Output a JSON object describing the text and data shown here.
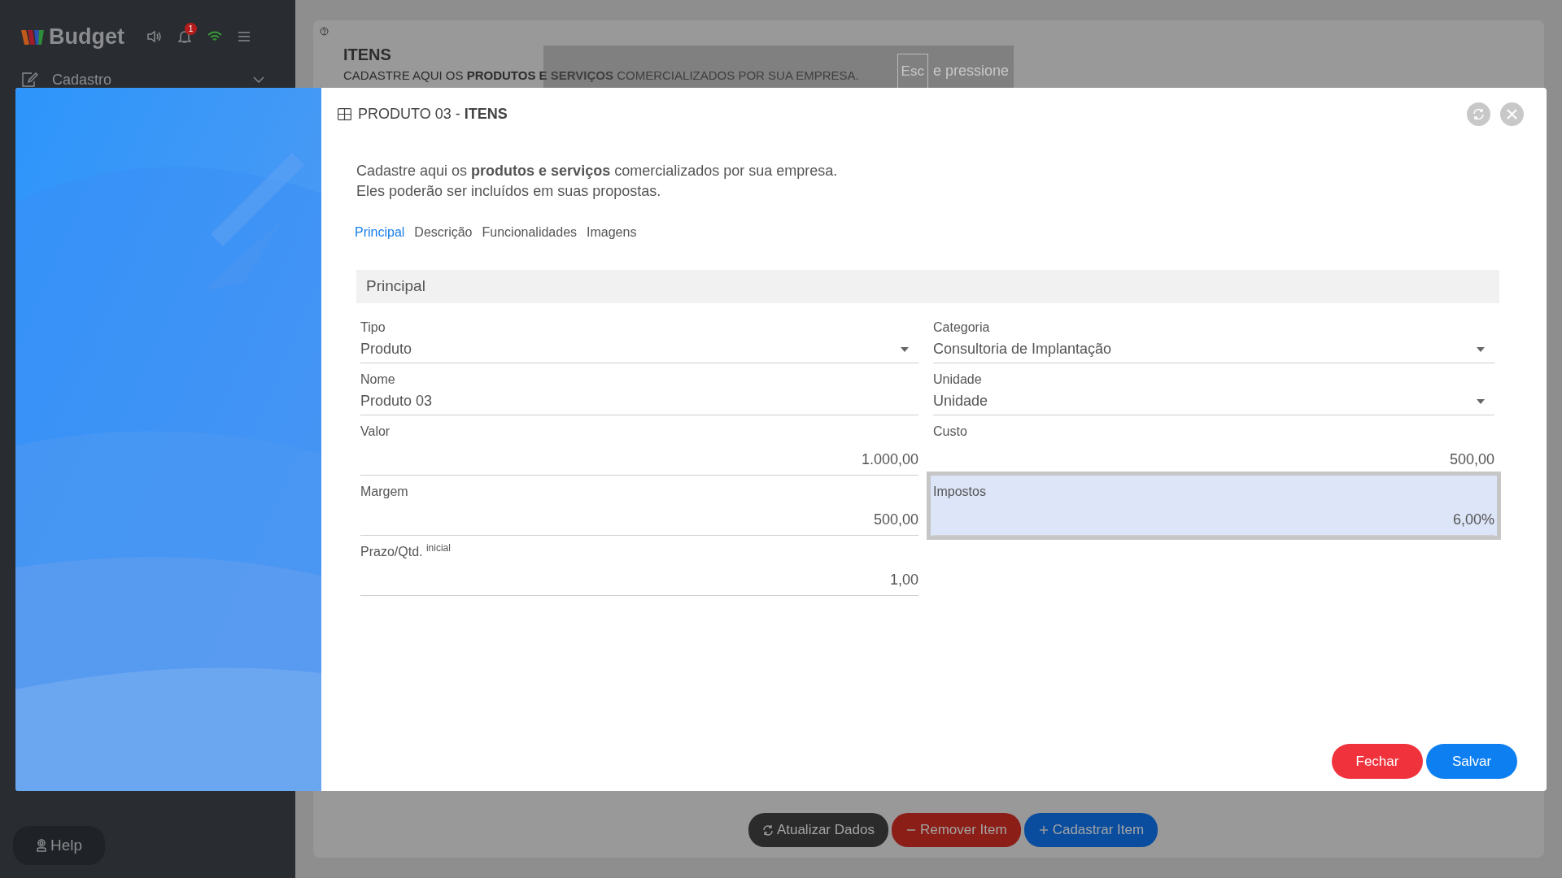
{
  "sidebar": {
    "logo": "Budget",
    "notification_count": "1",
    "menu": [
      {
        "label": "Cadastro",
        "expanded": false
      }
    ],
    "help": "Help"
  },
  "page": {
    "title": "ITENS",
    "subtitle": "CADASTRE AQUI OS **PRODUTOS E SERVIÇOS** COMERCIALIZADOS POR SUA EMPRESA.",
    "tooltip": {
      "key": "Esc",
      "text": "e pressione"
    },
    "buttons": [
      {
        "label": "Atualizar Dados",
        "kind": "refresh"
      },
      {
        "label": "Remover Item",
        "kind": "remove"
      },
      {
        "label": "Cadastrar Item",
        "kind": "add"
      }
    ]
  },
  "modal": {
    "title": "PRODUTO 03 - **ITENS**",
    "description": [
      "Cadastre aqui os **produtos e serviços** comercializados por sua empresa.",
      "Eles poderão ser incluídos em suas propostas."
    ],
    "tabs": [
      {
        "label": "Principal",
        "selected": true
      },
      {
        "label": "Descrição",
        "selected": false
      },
      {
        "label": "Funcionalidades",
        "selected": false
      },
      {
        "label": "Imagens",
        "selected": false
      }
    ],
    "section": "Principal",
    "fields": [
      {
        "label": "Tipo",
        "value": "Produto",
        "kind": "select",
        "focused": false
      },
      {
        "label": "Categoria",
        "value": "Consultoria de Implantação",
        "kind": "select",
        "focused": false
      },
      {
        "label": "Nome",
        "value": "Produto 03",
        "kind": "text",
        "focused": false
      },
      {
        "label": "Unidade",
        "value": "Unidade",
        "kind": "select",
        "focused": false
      },
      {
        "label": "Valor",
        "value": "1.000,00",
        "kind": "number",
        "focused": false
      },
      {
        "label": "Custo",
        "value": "500,00",
        "kind": "number",
        "focused": false
      },
      {
        "label": "Margem",
        "value": "500,00",
        "kind": "number",
        "focused": false
      },
      {
        "label": "Impostos",
        "value": "6,00%",
        "kind": "number",
        "focused": true
      },
      {
        "label": "Prazo/Qtd. $^{inicial}$",
        "value": "1,00",
        "kind": "number",
        "focused": false
      }
    ],
    "buttons": [
      {
        "label": "Fechar",
        "kind": "close"
      },
      {
        "label": "Salvar",
        "kind": "save"
      }
    ]
  }
}
